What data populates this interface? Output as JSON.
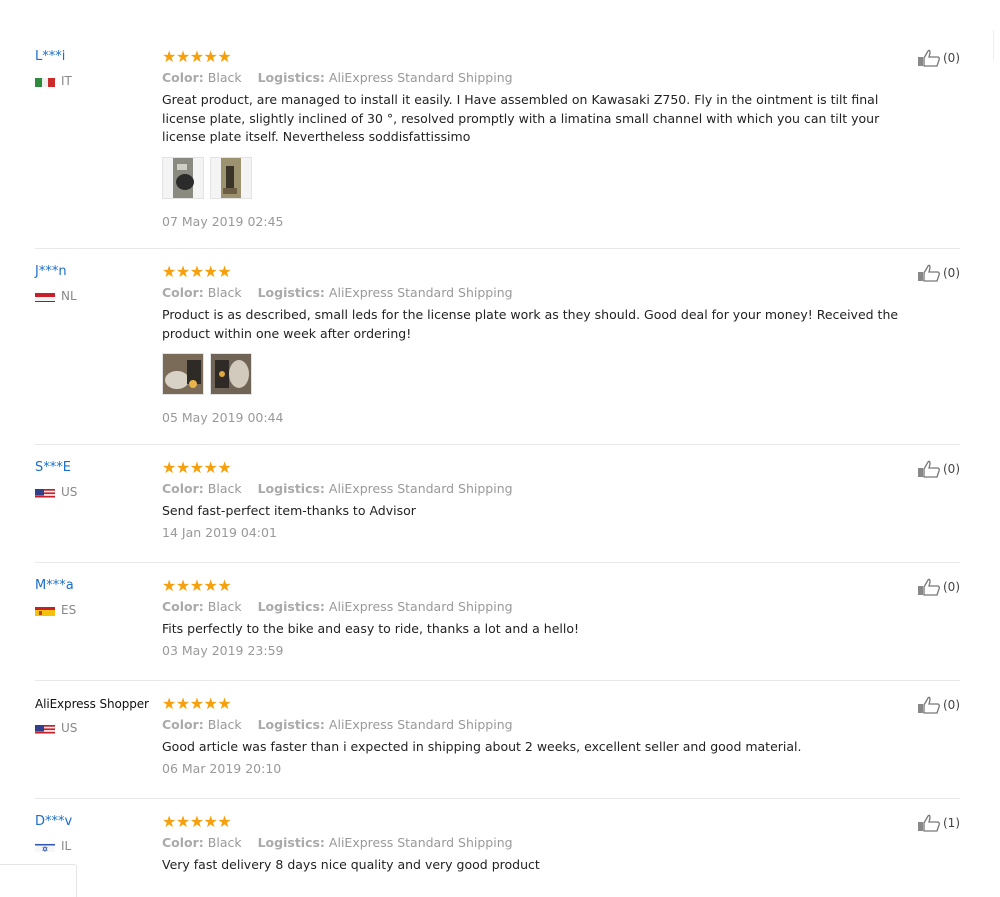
{
  "labels": {
    "color": "Color:",
    "logistics": "Logistics:"
  },
  "stars": "★★★★★",
  "reviews": [
    {
      "user": "L***i",
      "country": "IT",
      "color": "Black",
      "logistics": "AliExpress Standard Shipping",
      "text": "Great product, are managed to install it easily. I Have assembled on Kawasaki Z750. Fly in the ointment is tilt final license plate, slightly inclined of 30 °, resolved promptly with a limatina small channel with which you can tilt your license plate itself. Nevertheless soddisfattissimo",
      "date": "07 May 2019 02:45",
      "helpful": "(0)",
      "photos": 2
    },
    {
      "user": "J***n",
      "country": "NL",
      "color": "Black",
      "logistics": "AliExpress Standard Shipping",
      "text": "Product is as described, small leds for the license plate work as they should. Good deal for your money! Received the product within one week after ordering!",
      "date": "05 May 2019 00:44",
      "helpful": "(0)",
      "photos": 2
    },
    {
      "user": "S***E",
      "country": "US",
      "color": "Black",
      "logistics": "AliExpress Standard Shipping",
      "text": "Send fast-perfect item-thanks to Advisor",
      "date": "14 Jan 2019 04:01",
      "helpful": "(0)",
      "photos": 0
    },
    {
      "user": "M***a",
      "country": "ES",
      "color": "Black",
      "logistics": "AliExpress Standard Shipping",
      "text": "Fits perfectly to the bike and easy to ride, thanks a lot and a hello!",
      "date": "03 May 2019 23:59",
      "helpful": "(0)",
      "photos": 0
    },
    {
      "user": "AliExpress Shopper",
      "country": "US",
      "color": "Black",
      "logistics": "AliExpress Standard Shipping",
      "text": "Good article was faster than i expected in shipping about 2 weeks, excellent seller and good material.",
      "date": "06 Mar 2019 20:10",
      "helpful": "(0)",
      "photos": 0
    },
    {
      "user": "D***v",
      "country": "IL",
      "color": "Black",
      "logistics": "AliExpress Standard Shipping",
      "text": "Very fast delivery 8 days nice quality and very good product",
      "date": "",
      "helpful": "(1)",
      "photos": 0
    }
  ]
}
